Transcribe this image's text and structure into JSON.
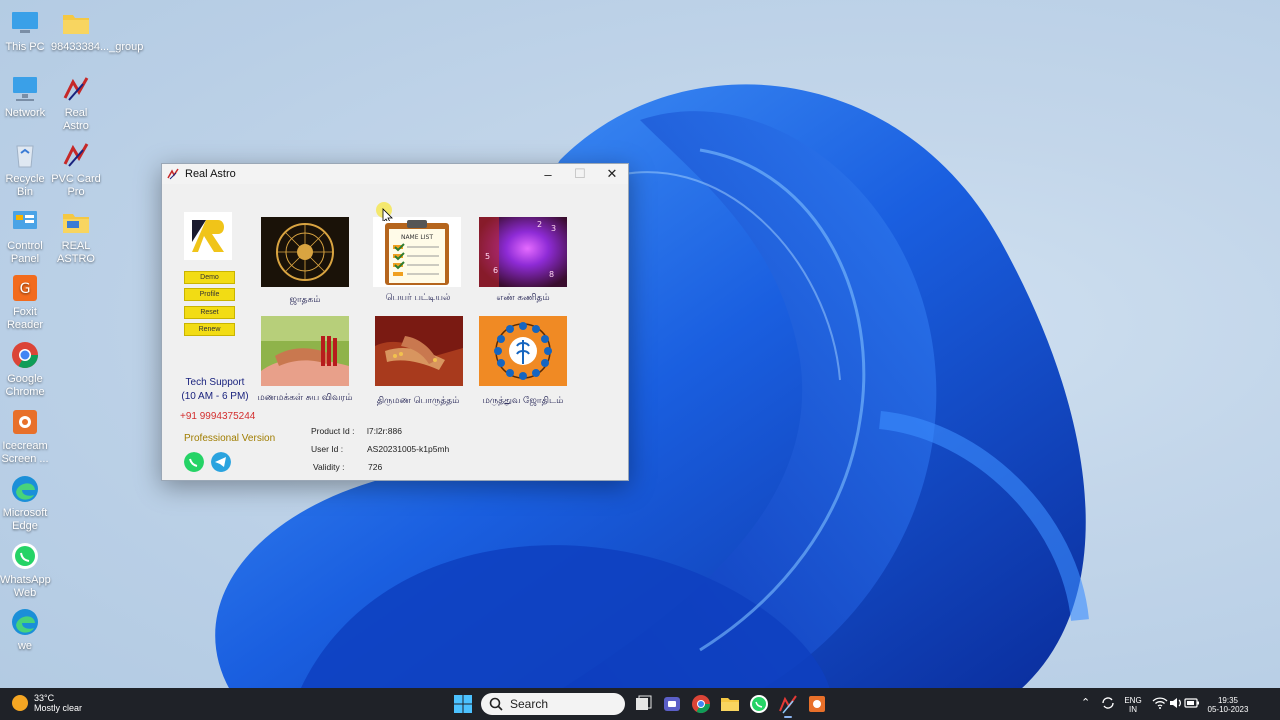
{
  "desktop": {
    "icons": [
      {
        "label": "This PC"
      },
      {
        "label": "98433384..._group"
      },
      {
        "label": "Network"
      },
      {
        "label": "Real Astro"
      },
      {
        "label": "Recycle Bin"
      },
      {
        "label": "PVC Card Pro"
      },
      {
        "label": "Control Panel"
      },
      {
        "label": "REAL ASTRO"
      },
      {
        "label": "Foxit Reader"
      },
      {
        "label": "Google Chrome"
      },
      {
        "label": "Icecream Screen ..."
      },
      {
        "label": "Microsoft Edge"
      },
      {
        "label": "WhatsApp Web"
      },
      {
        "label": "we"
      }
    ]
  },
  "window": {
    "title": "Real Astro",
    "side_buttons": {
      "demo": "Demo",
      "profile": "Profile",
      "reset": "Reset",
      "renew": "Renew"
    },
    "tiles": [
      {
        "label": "ஜாதகம்",
        "icon": "zodiac-wheel"
      },
      {
        "label": "பெயர் பட்டியல்",
        "icon": "name-list-clipboard"
      },
      {
        "label": "எண் கணிதம்",
        "icon": "numerology-galaxy"
      },
      {
        "label": "மணமக்கள் சுய விவரம்",
        "icon": "bridal-hands"
      },
      {
        "label": "திருமண பொருத்தம்",
        "icon": "wedding-hands"
      },
      {
        "label": "மருத்துவ ஜோதிடம்",
        "icon": "medical-astrology"
      }
    ],
    "support": {
      "title": "Tech Support",
      "hours": "(10 AM - 6 PM)",
      "phone": "+91 9994375244"
    },
    "version": "Professional Version",
    "info": {
      "product_key": "Product Id :",
      "product_val": "l7:l2r:886",
      "user_key": "User Id :",
      "user_val": "AS20231005-k1p5mh",
      "validity_key": "Validity :",
      "validity_val": "726"
    }
  },
  "taskbar": {
    "weather_temp": "33°C",
    "weather_desc": "Mostly clear",
    "search_placeholder": "Search",
    "lang1": "ENG",
    "lang2": "IN",
    "time": "19:35",
    "date": "05-10-2023"
  },
  "colors": {
    "accent_blue": "#1565c0",
    "button_yellow": "#f2dc14",
    "taskbar": "#1f2228"
  }
}
